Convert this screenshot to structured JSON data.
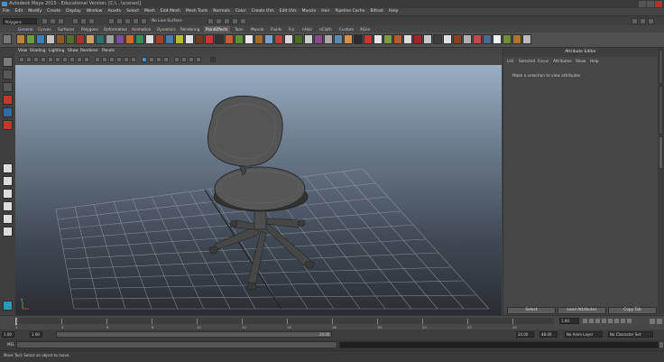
{
  "window": {
    "title": "Autodesk Maya 2015 - Educational Version: [C:\\...\\scenes\\]"
  },
  "menubar": {
    "items": [
      "File",
      "Edit",
      "Modify",
      "Create",
      "Display",
      "Window",
      "Assets",
      "Select",
      "Mesh",
      "Edit Mesh",
      "Mesh Tools",
      "Normals",
      "Color",
      "Create UVs",
      "Edit UVs",
      "Muscle",
      "Hair",
      "Pipeline Cache",
      "Bifrost",
      "Help"
    ]
  },
  "status_line": {
    "mode": "Polygons",
    "live_surface": "No Live Surface"
  },
  "shelf": {
    "tabs": [
      "General",
      "Curves",
      "Surfaces",
      "Polygons",
      "Deformation",
      "Animation",
      "Dynamics",
      "Rendering",
      "PaintEffects",
      "Toon",
      "Muscle",
      "Fluids",
      "Fur",
      "nHair",
      "nCloth",
      "Custom",
      "XGen"
    ],
    "active_tab": "PaintEffects"
  },
  "viewport": {
    "menu": [
      "View",
      "Shading",
      "Lighting",
      "Show",
      "Renderer",
      "Panels"
    ],
    "axis_label": "y"
  },
  "attribute_editor": {
    "title": "Attribute Editor",
    "tabs": [
      "List",
      "Selected",
      "Focus",
      "Attributes",
      "Show",
      "Help"
    ],
    "message": "Make a selection to view attributes",
    "buttons": [
      "Select",
      "Load Attributes",
      "Copy Tab"
    ]
  },
  "side_tabs": [
    "Tool Settings",
    "Channel Box / Layer Editor",
    "Attribute Editor"
  ],
  "time_slider": {
    "labels": [
      "1",
      "2",
      "4",
      "6",
      "8",
      "10",
      "12",
      "14",
      "16",
      "18",
      "20",
      "22",
      "24"
    ],
    "current_frame": "1.00"
  },
  "range_slider": {
    "start": "1.00",
    "inner_start": "1.00",
    "inner_end": "24.00",
    "end": "24.00",
    "max_end": "48.00",
    "anim_layer": "No Anim Layer",
    "character_set": "No Character Set"
  },
  "command_line": {
    "label": "MEL"
  },
  "help_line": {
    "text": "Move Tool: Select an object to move."
  },
  "colors": {
    "viewport_top": "#9aaec4",
    "viewport_bottom": "#2a2e33",
    "chair": "#4a4a4a",
    "grid": "#9aa0a8",
    "ui_bg": "#444444"
  },
  "icons": [
    "maya-logo-icon",
    "select-tool-icon",
    "lasso-tool-icon",
    "paint-select-icon",
    "move-tool-icon",
    "rotate-tool-icon",
    "scale-tool-icon",
    "camera-icon",
    "play-forward-icon",
    "play-back-icon",
    "key-icon"
  ]
}
